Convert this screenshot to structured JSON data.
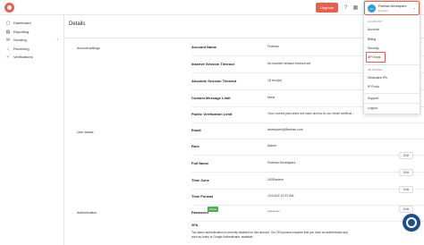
{
  "topbar": {
    "upgrade_label": "Upgrade",
    "help_icon": "help-icon",
    "apps_icon": "grid-icon"
  },
  "sidebar": {
    "items": [
      {
        "label": "Dashboard",
        "icon": "dashboard-icon"
      },
      {
        "label": "Reporting",
        "icon": "reporting-icon"
      },
      {
        "label": "Sending",
        "icon": "sending-icon"
      },
      {
        "label": "Receiving",
        "icon": "receiving-icon"
      },
      {
        "label": "Verifications",
        "icon": "verifications-icon"
      }
    ]
  },
  "main": {
    "title": "Details",
    "sections": {
      "account_settings": "Account settings",
      "user_details": "User details",
      "authentication": "Authentication"
    },
    "rows": {
      "account_name": {
        "label": "Account Name",
        "value": "Fivetran"
      },
      "inactive_timeout": {
        "label": "Inactive Session Timeout",
        "value": "No inactive session timeout set"
      },
      "absolute_timeout": {
        "label": "Absolute Session Timeout",
        "value": "18 hour(s)"
      },
      "custom_message_limit": {
        "label": "Custom Message Limit",
        "value": "None"
      },
      "public_verification_limit": {
        "label": "Public Verification Limit",
        "value": "Your current plan does not have access to our email verificat..."
      },
      "email": {
        "label": "Email",
        "value": "developers@fivetran.com"
      },
      "role": {
        "label": "Role",
        "value": "Admin"
      },
      "full_name": {
        "label": "Full Name",
        "value": "Fivetran Developers"
      },
      "time_zone": {
        "label": "Time Zone",
        "value": "US/Eastern"
      },
      "time_format": {
        "label": "Time Format",
        "value": "12/14/22 12:37 AM"
      },
      "password": {
        "label": "Password",
        "value": "**********",
        "badge": "Active"
      },
      "tfa": {
        "label": "2FA"
      }
    },
    "tfa_text_1": "Two-factor authentication is currently disabled on this account. Our 2FA process requires that you have an authenticator app,",
    "tfa_text_2": "such as Authy or Google Authenticator, available",
    "edit_label": "Edit"
  },
  "dropdown": {
    "avatar_initials": "FD",
    "name": "Fivetran Developers",
    "sub": "Fivetran",
    "account_section": "ACCOUNT",
    "account_items": [
      "Account",
      "Billing",
      "Security",
      "API Keys"
    ],
    "settings_section": "SETTINGS",
    "settings_items": [
      "Dedicated IPs",
      "IP Pools"
    ],
    "support": "Support",
    "logout": "Logout"
  }
}
